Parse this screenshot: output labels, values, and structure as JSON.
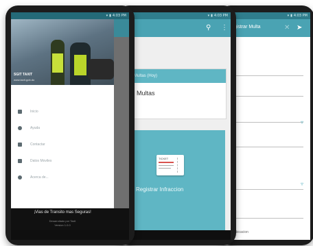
{
  "status": {
    "time": "4:03 PM"
  },
  "phone_left": {
    "drawer": {
      "org_name": "SGIT TAXIT",
      "org_url": "www.taxit.gob.do",
      "items": [
        {
          "label": "Inicio",
          "icon": "home-icon"
        },
        {
          "label": "Ayuda",
          "icon": "help-icon"
        },
        {
          "label": "Contactar",
          "icon": "person-icon"
        },
        {
          "label": "Datos Moviles",
          "icon": "signal-icon"
        },
        {
          "label": "Acerca de...",
          "icon": "info-icon"
        }
      ],
      "slogan": "¡Vias de Transito mas Seguras!",
      "footer_line1": "Desarrollado por Taxit",
      "footer_line2": "Version 1.0.0"
    }
  },
  "phone_middle": {
    "card_header": "Multas (Hoy)",
    "card_value": "Multas",
    "ticket_label": "TICKET",
    "register_label": "Registrar Infraccion"
  },
  "phone_right": {
    "title": "Registrar Multa",
    "footer_text": "Ubicacion"
  },
  "colors": {
    "primary": "#4aa3b3",
    "primary_dark": "#2f7d8c",
    "accent": "#5fb6c4"
  }
}
